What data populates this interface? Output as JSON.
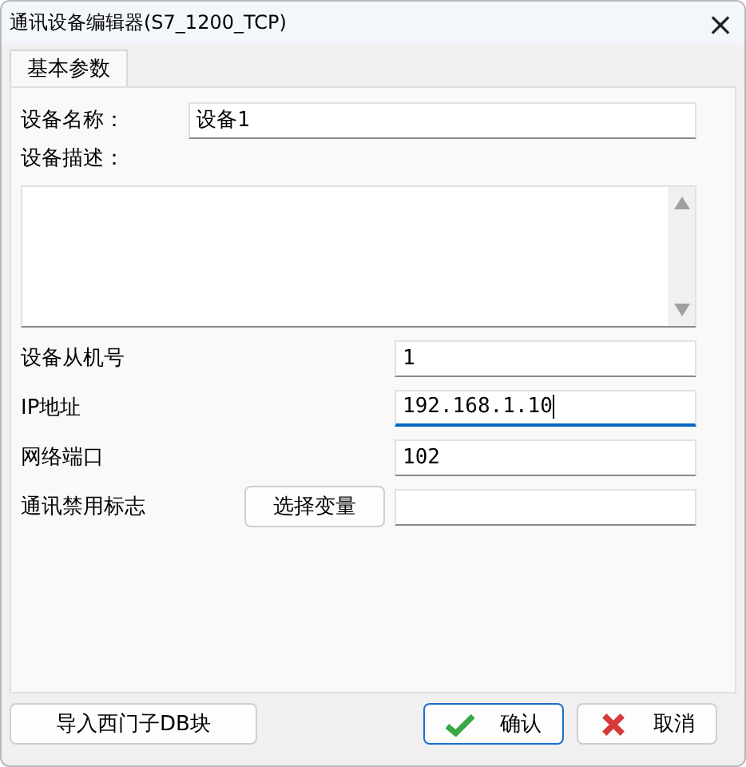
{
  "window": {
    "title": "通讯设备编辑器(S7_1200_TCP)",
    "close": "×"
  },
  "tabs": [
    {
      "label": "基本参数",
      "selected": true
    }
  ],
  "name": {
    "label": "设备名称：",
    "value": "设备1"
  },
  "description": {
    "label": "设备描述："
  },
  "fields": [
    {
      "label": "设备从机号",
      "value": "1",
      "focused": false
    },
    {
      "label": "IP地址",
      "value": "192.168.1.10",
      "focused": true
    },
    {
      "label": "网络端口",
      "value": "102",
      "focused": false
    }
  ],
  "disable_flag": {
    "label": "通讯禁用标志",
    "button": "选择变量"
  },
  "buttons": {
    "import": "导入西门子DB块",
    "ok": "确认",
    "cancel": "取消"
  }
}
